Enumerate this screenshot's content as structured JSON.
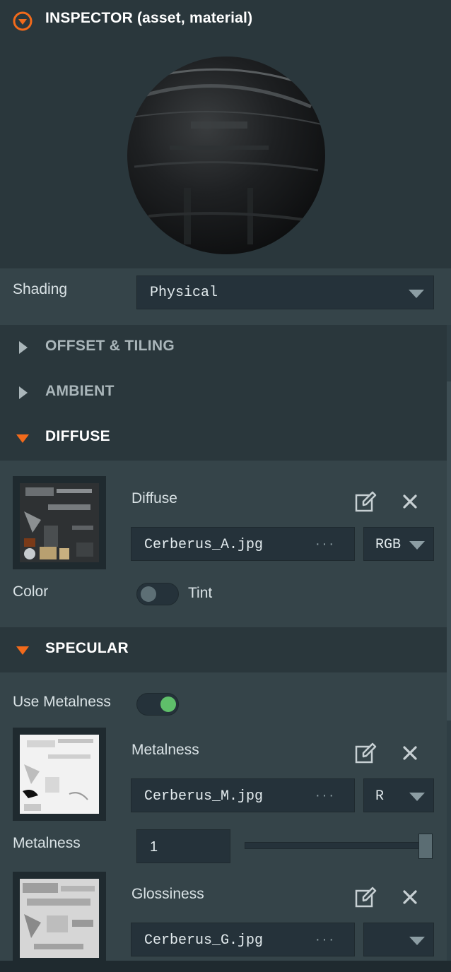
{
  "header": {
    "title": "INSPECTOR (asset, material)"
  },
  "shading": {
    "label": "Shading",
    "value": "Physical"
  },
  "sections": {
    "offset_tiling": "OFFSET & TILING",
    "ambient": "AMBIENT",
    "diffuse": "DIFFUSE",
    "specular": "SPECULAR"
  },
  "diffuse": {
    "map_label": "Diffuse",
    "file": "Cerberus_A.jpg",
    "channel": "RGB",
    "color_label": "Color",
    "tint_label": "Tint"
  },
  "specular": {
    "use_metalness_label": "Use Metalness",
    "metalness_map_label": "Metalness",
    "metalness_file": "Cerberus_M.jpg",
    "metalness_channel": "R",
    "metalness_label": "Metalness",
    "metalness_value": "1",
    "metalness_slider": 1.0,
    "glossiness_map_label": "Glossiness",
    "glossiness_file": "Cerberus_G.jpg",
    "glossiness_channel": ""
  },
  "colors": {
    "accent": "#f26a1b",
    "toggle_on": "#5fbf6a"
  },
  "icons": {
    "collapse": "collapse-circle-icon",
    "edit": "edit-icon",
    "clear": "close-icon",
    "dropdown": "caret-down-icon",
    "more": "ellipsis-icon",
    "expand": "caret-right-icon",
    "collapse_section": "caret-down-icon"
  }
}
